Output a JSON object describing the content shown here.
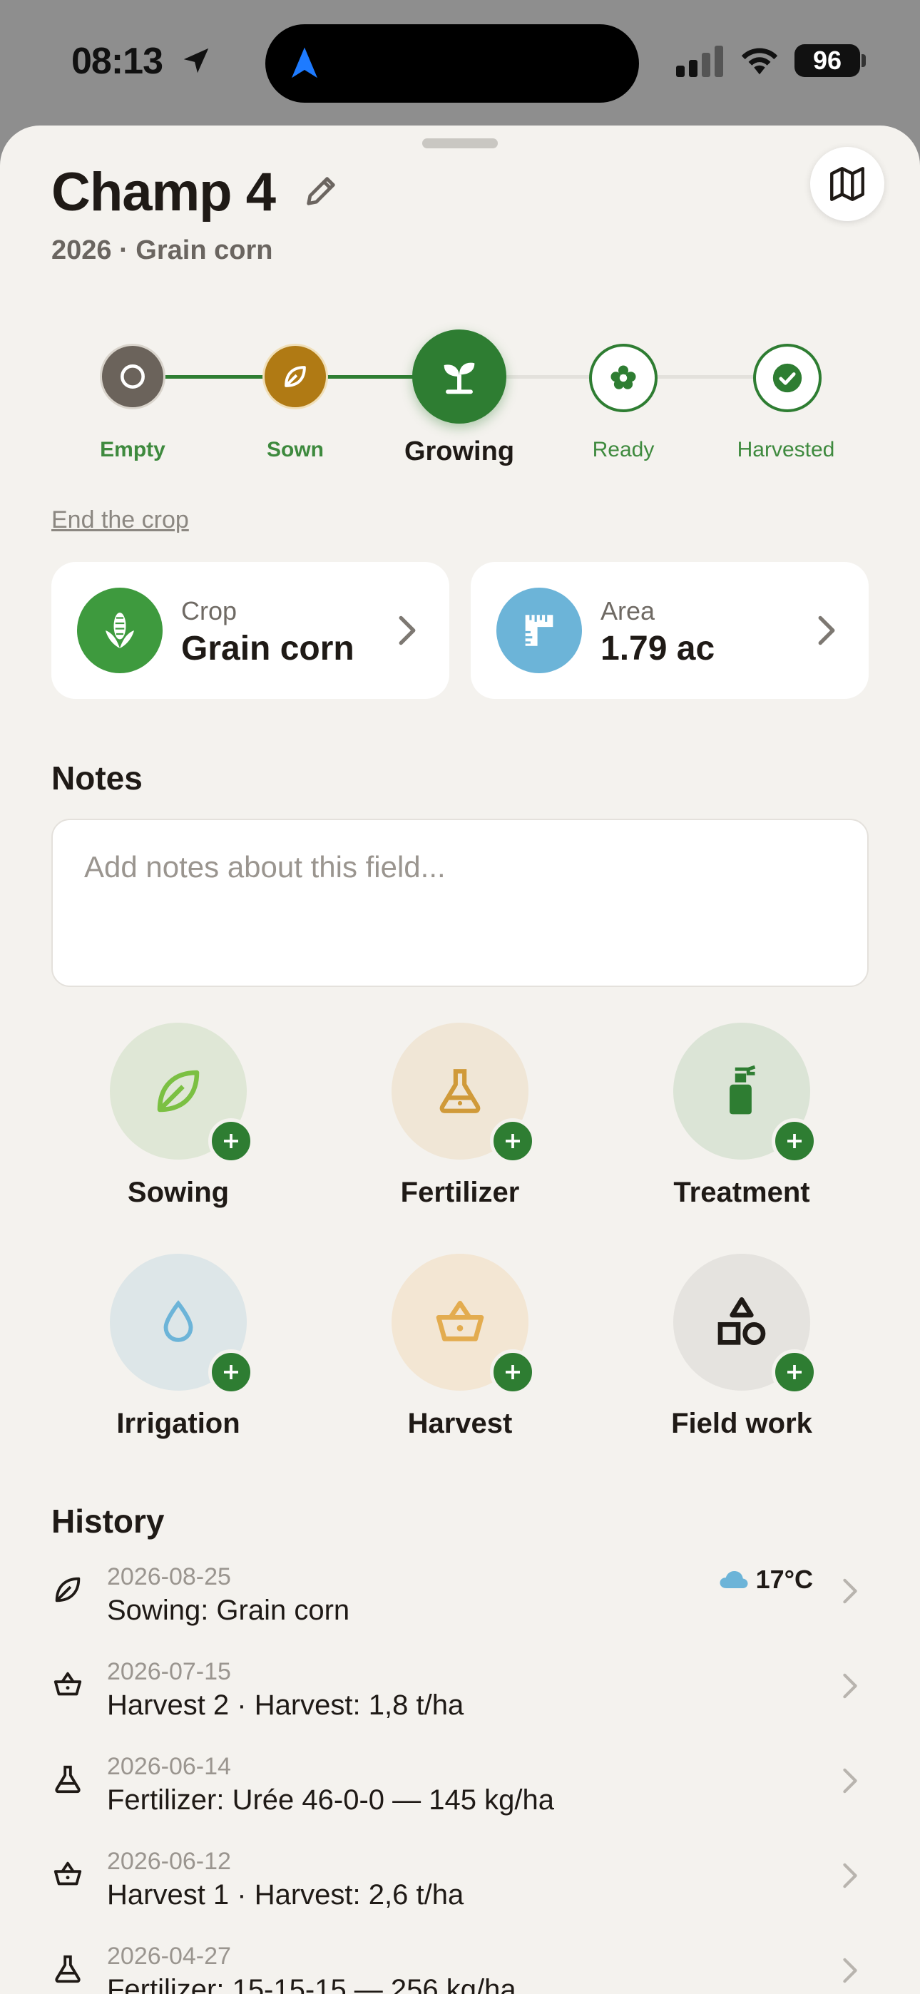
{
  "status_bar": {
    "time": "08:13",
    "battery": "96"
  },
  "field": {
    "name": "Champ 4",
    "subtitle": "2026 · Grain corn"
  },
  "stages": [
    {
      "label": "Empty",
      "state": "done"
    },
    {
      "label": "Sown",
      "state": "done"
    },
    {
      "label": "Growing",
      "state": "current"
    },
    {
      "label": "Ready",
      "state": "upcoming"
    },
    {
      "label": "Harvested",
      "state": "upcoming"
    }
  ],
  "end_crop_label": "End the crop",
  "cards": {
    "crop": {
      "label": "Crop",
      "value": "Grain corn",
      "icon": "corn-icon",
      "color": "#3e9a3e"
    },
    "area": {
      "label": "Area",
      "value": "1.79 ac",
      "icon": "ruler-icon",
      "color": "#6cb4d8"
    }
  },
  "notes": {
    "title": "Notes",
    "placeholder": "Add notes about this field..."
  },
  "actions": [
    {
      "label": "Sowing",
      "icon": "leaf-icon",
      "bg": "#dfe7d6"
    },
    {
      "label": "Fertilizer",
      "icon": "flask-icon",
      "bg": "#f0e6d6"
    },
    {
      "label": "Treatment",
      "icon": "spray-bottle-icon",
      "bg": "#dbe4d6"
    },
    {
      "label": "Irrigation",
      "icon": "droplet-icon",
      "bg": "#dde6e8"
    },
    {
      "label": "Harvest",
      "icon": "basket-icon",
      "bg": "#f3e6d3"
    },
    {
      "label": "Field work",
      "icon": "shapes-icon",
      "bg": "#e5e3df"
    }
  ],
  "history": {
    "title": "History",
    "items": [
      {
        "date": "2026-08-25",
        "text": "Sowing: Grain corn",
        "icon": "leaf-icon",
        "weather": "17°C"
      },
      {
        "date": "2026-07-15",
        "text": "Harvest 2 · Harvest: 1,8 t/ha",
        "icon": "basket-icon"
      },
      {
        "date": "2026-06-14",
        "text": "Fertilizer: Urée 46-0-0 — 145 kg/ha",
        "icon": "flask-icon"
      },
      {
        "date": "2026-06-12",
        "text": "Harvest 1 · Harvest: 2,6 t/ha",
        "icon": "basket-icon"
      },
      {
        "date": "2026-04-27",
        "text": "Fertilizer: 15-15-15 — 256 kg/ha",
        "icon": "flask-icon"
      }
    ]
  },
  "colors": {
    "accent_green": "#2e7d32",
    "brown": "#6b635b",
    "amber": "#b07a14",
    "sheet_bg": "#f4f2ee"
  }
}
